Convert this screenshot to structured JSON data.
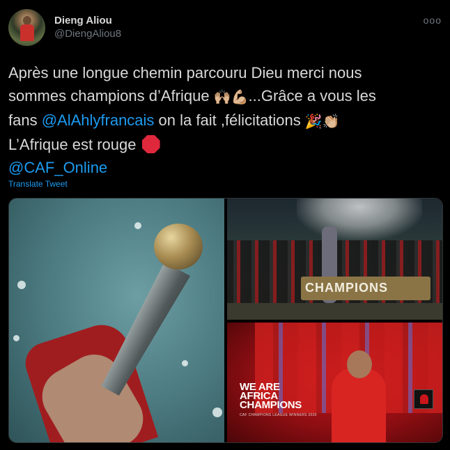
{
  "user": {
    "display_name": "Dieng Aliou",
    "handle": "@DiengAliou8"
  },
  "more_label": "ooo",
  "tweet": {
    "line1": "Après une longue chemin parcouru Dieu merci nous",
    "line2_a": "sommes champions d’Afrique ",
    "emoji_hands": "🙌🏼💪🏼",
    "line2_b": "...Grâce a vous les",
    "line3_a": "fans ",
    "mention_1": "@AlAhlyfrancais",
    "line3_b": " on la fait ,félicitations ",
    "emoji_party": "🎉👏🏼",
    "line4": "L’Afrique est rouge ",
    "mention_2": "@CAF_Online"
  },
  "translate_label": "Translate Tweet",
  "media": {
    "banner_text": "CHAMPIONS",
    "headline": [
      "WE ARE",
      "AFRICA",
      "CHAMPIONS"
    ],
    "subline": "CAF CHAMPIONS LEAGUE WINNERS 2020"
  },
  "colors": {
    "background": "#000000",
    "text": "#d9d9d9",
    "secondary": "#6e767d",
    "link": "#1d9bf0",
    "club_red": "#c2161b"
  },
  "icons": {
    "more": "more-horizontal-icon",
    "stop": "stop-sign-emoji"
  }
}
